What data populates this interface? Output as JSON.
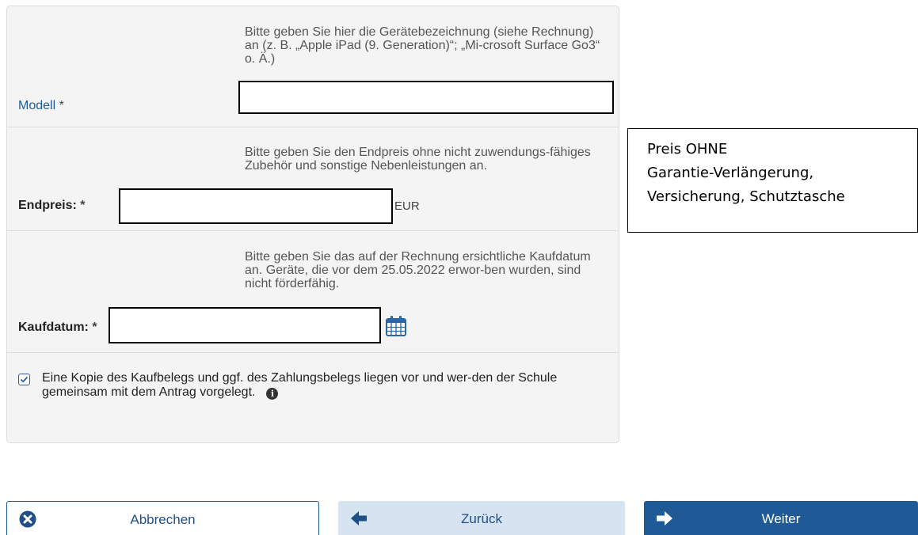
{
  "form": {
    "model": {
      "label": "Modell",
      "required_mark": "*",
      "hint": "Bitte geben Sie hier die Gerätebezeichnung (siehe Rechnung) an (z. B. „Apple iPad (9. Generation)“; „Mi-crosoft Surface Go3“ o. Ä.)",
      "value": ""
    },
    "price": {
      "label": "Endpreis:",
      "required_mark": "*",
      "hint": "Bitte geben Sie den Endpreis ohne nicht zuwendungs-fähiges Zubehör und sonstige Nebenleistungen an.",
      "value": "",
      "unit": "EUR"
    },
    "purchase_date": {
      "label": "Kaufdatum:",
      "required_mark": "*",
      "hint": "Bitte geben Sie das auf der Rechnung ersichtliche Kaufdatum an. Geräte, die vor dem 25.05.2022 erwor-ben wurden, sind nicht förderfähig.",
      "value": "",
      "calendar_icon": "calendar-icon"
    },
    "confirmation": {
      "checked": true,
      "text": "Eine Kopie des Kaufbelegs und ggf. des Zahlungsbelegs liegen vor und wer-den der Schule gemeinsam mit dem Antrag vorgelegt.",
      "info_icon": "info-icon"
    }
  },
  "annotation": {
    "line1": "Preis OHNE",
    "line2": "Garantie-Verlängerung,",
    "line3": "Versicherung, Schutztasche"
  },
  "buttons": {
    "cancel": {
      "label": "Abbrechen",
      "icon": "x-circle-icon"
    },
    "back": {
      "label": "Zurück",
      "icon": "arrow-left-icon"
    },
    "next": {
      "label": "Weiter",
      "icon": "arrow-right-icon"
    }
  },
  "colors": {
    "primary": "#1f5a96",
    "secondary_bg": "#d6e4f1",
    "panel_bg": "#f4f4f4",
    "calendar": "#2a66a8"
  }
}
